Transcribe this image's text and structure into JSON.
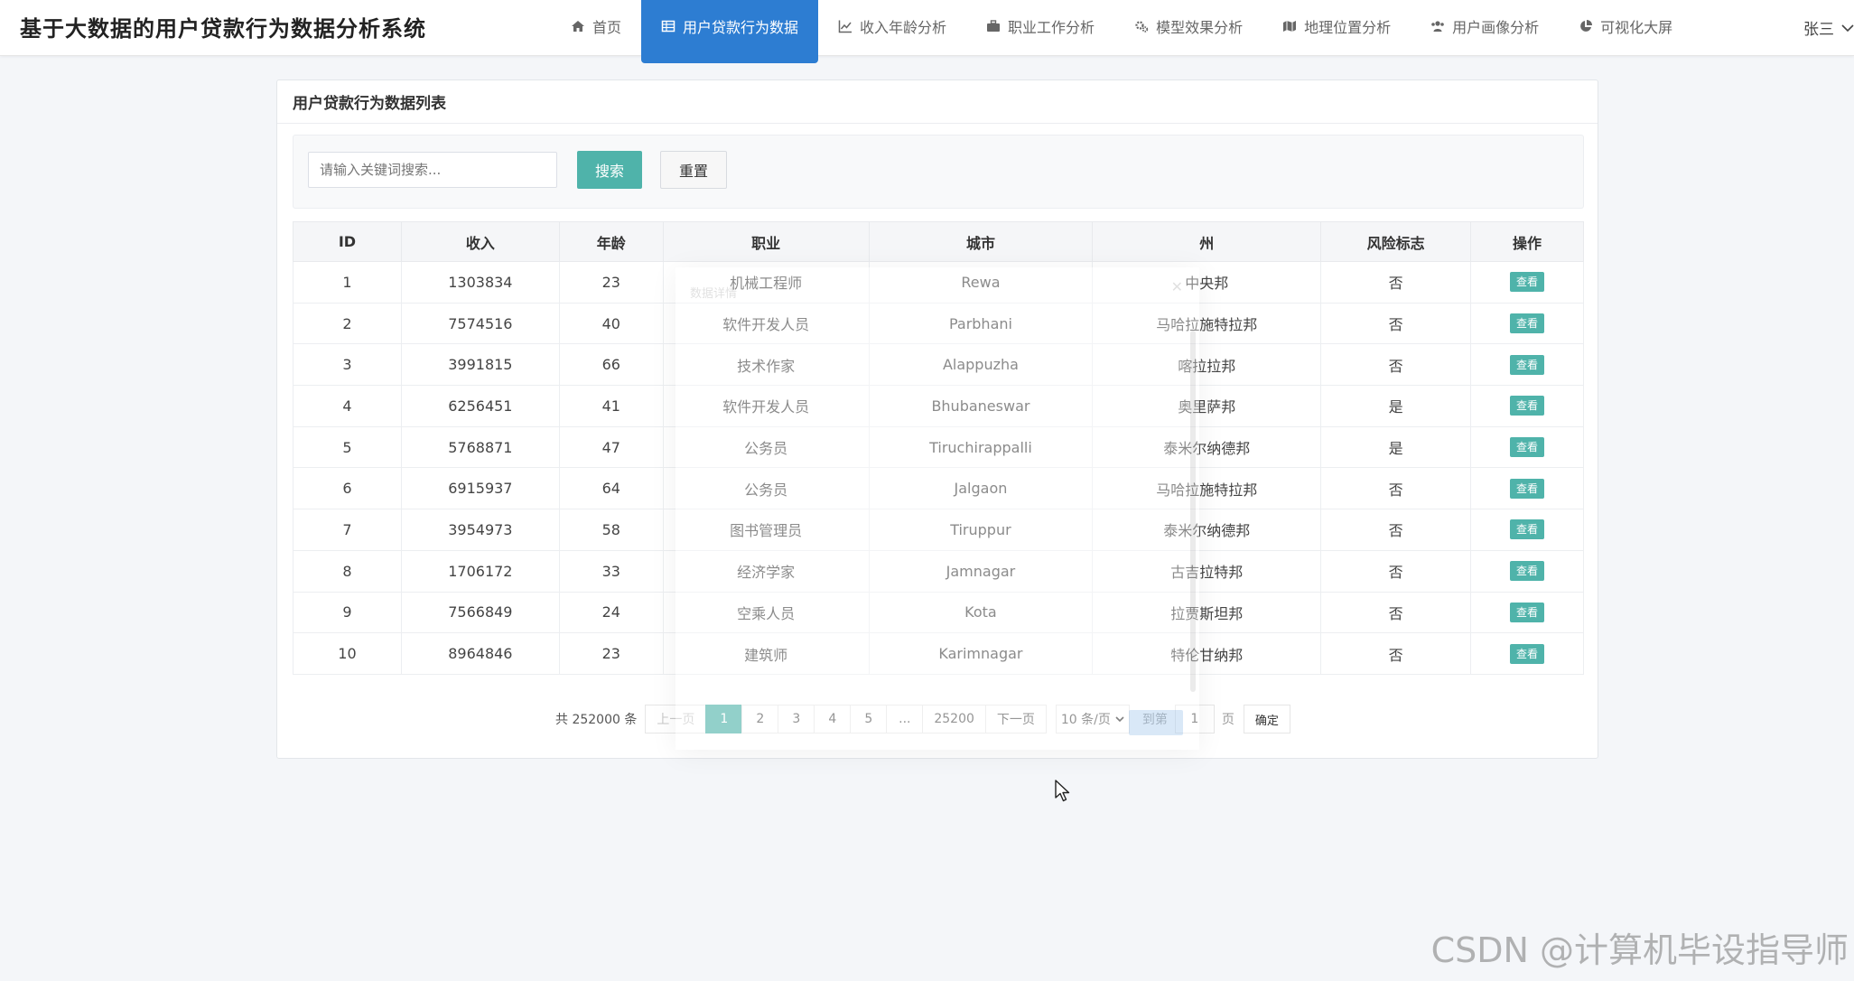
{
  "app": {
    "title": "基于大数据的用户贷款行为数据分析系统"
  },
  "nav": {
    "items": [
      {
        "label": "首页",
        "icon": "home-icon",
        "active": false
      },
      {
        "label": "用户贷款行为数据",
        "icon": "table-icon",
        "active": true
      },
      {
        "label": "收入年龄分析",
        "icon": "line-chart-icon",
        "active": false
      },
      {
        "label": "职业工作分析",
        "icon": "briefcase-icon",
        "active": false
      },
      {
        "label": "模型效果分析",
        "icon": "gears-icon",
        "active": false
      },
      {
        "label": "地理位置分析",
        "icon": "map-icon",
        "active": false
      },
      {
        "label": "用户画像分析",
        "icon": "users-icon",
        "active": false
      },
      {
        "label": "可视化大屏",
        "icon": "pie-chart-icon",
        "active": false
      }
    ],
    "user": "张三"
  },
  "panel": {
    "title": "用户贷款行为数据列表"
  },
  "search": {
    "placeholder": "请输入关键词搜索...",
    "search_label": "搜索",
    "reset_label": "重置"
  },
  "table": {
    "headers": [
      "ID",
      "收入",
      "年龄",
      "职业",
      "城市",
      "州",
      "风险标志",
      "操作"
    ],
    "action_label": "查看",
    "rows": [
      [
        "1",
        "1303834",
        "23",
        "机械工程师",
        "Rewa",
        "中央邦",
        "否"
      ],
      [
        "2",
        "7574516",
        "40",
        "软件开发人员",
        "Parbhani",
        "马哈拉施特拉邦",
        "否"
      ],
      [
        "3",
        "3991815",
        "66",
        "技术作家",
        "Alappuzha",
        "喀拉拉邦",
        "否"
      ],
      [
        "4",
        "6256451",
        "41",
        "软件开发人员",
        "Bhubaneswar",
        "奥里萨邦",
        "是"
      ],
      [
        "5",
        "5768871",
        "47",
        "公务员",
        "Tiruchirappalli",
        "泰米尔纳德邦",
        "是"
      ],
      [
        "6",
        "6915937",
        "64",
        "公务员",
        "Jalgaon",
        "马哈拉施特拉邦",
        "否"
      ],
      [
        "7",
        "3954973",
        "58",
        "图书管理员",
        "Tiruppur",
        "泰米尔纳德邦",
        "否"
      ],
      [
        "8",
        "1706172",
        "33",
        "经济学家",
        "Jamnagar",
        "古吉拉特邦",
        "否"
      ],
      [
        "9",
        "7566849",
        "24",
        "空乘人员",
        "Kota",
        "拉贾斯坦邦",
        "否"
      ],
      [
        "10",
        "8964846",
        "23",
        "建筑师",
        "Karimnagar",
        "特伦甘纳邦",
        "否"
      ]
    ]
  },
  "pagination": {
    "total": "共 252000 条",
    "prev": "上一页",
    "pages": [
      "1",
      "2",
      "3",
      "4",
      "5",
      "...",
      "25200"
    ],
    "current": "1",
    "next": "下一页",
    "page_size": "10 条/页",
    "goto_label": "到第",
    "goto_value": "1",
    "page_unit": "页",
    "confirm": "确定"
  },
  "modal": {
    "title": "数据详情"
  },
  "watermark": "CSDN @计算机毕设指导师",
  "colors": {
    "primary": "#2d7dd2",
    "teal": "#4fb3aa"
  }
}
